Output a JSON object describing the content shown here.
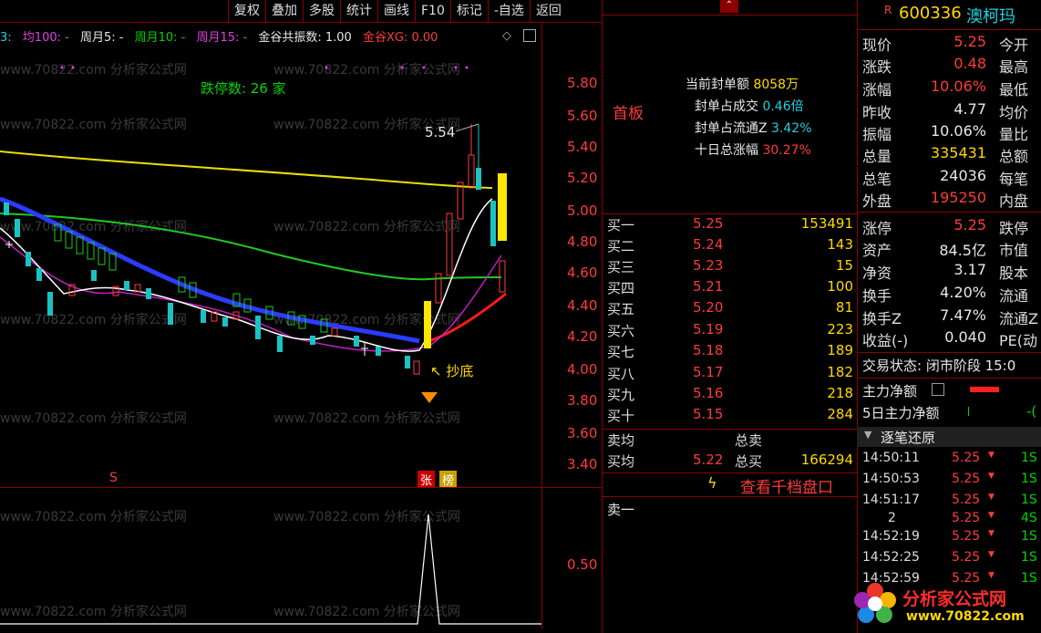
{
  "toolbar": {
    "buttons": [
      "复权",
      "叠加",
      "多股",
      "统计",
      "画线",
      "F10",
      "标记",
      "-自选",
      "返回"
    ]
  },
  "indicators": {
    "ma100": "均100: -",
    "week5": "周月5: -",
    "week10": "周月10: -",
    "week15": "周月15: -",
    "resonance": "金谷共振数: 1.00",
    "xg": "金谷XG: 0.00",
    "prefix": "3:"
  },
  "chart": {
    "limit_down_count": "跌停数: 26 家",
    "high_label": "5.54",
    "bottom_label": "抄底",
    "marker_s": "S",
    "badge_zhang": "张",
    "badge_bang": "榜",
    "price_axis": [
      "5.80",
      "5.60",
      "5.40",
      "5.20",
      "5.00",
      "4.80",
      "4.60",
      "4.40",
      "4.20",
      "4.00",
      "3.80",
      "3.60",
      "3.40"
    ],
    "sub_axis": "0.50",
    "watermark": "www.70822.com 分析家公式网"
  },
  "seal": {
    "first_board": "首板",
    "order_amount_label": "当前封单额",
    "order_amount": "8058万",
    "order_turnover_label": "封单占成交",
    "order_turnover": "0.46倍",
    "order_float_label": "封单占流通Z",
    "order_float": "3.42%",
    "ten_day_label": "十日总涨幅",
    "ten_day": "30.27%"
  },
  "orderbook": {
    "bids": [
      {
        "label": "买一",
        "price": "5.25",
        "vol": "153491"
      },
      {
        "label": "买二",
        "price": "5.24",
        "vol": "143"
      },
      {
        "label": "买三",
        "price": "5.23",
        "vol": "15"
      },
      {
        "label": "买四",
        "price": "5.21",
        "vol": "100"
      },
      {
        "label": "买五",
        "price": "5.20",
        "vol": "81"
      },
      {
        "label": "买六",
        "price": "5.19",
        "vol": "223"
      },
      {
        "label": "买七",
        "price": "5.18",
        "vol": "189"
      },
      {
        "label": "买八",
        "price": "5.17",
        "vol": "182"
      },
      {
        "label": "买九",
        "price": "5.16",
        "vol": "218"
      },
      {
        "label": "买十",
        "price": "5.15",
        "vol": "284"
      }
    ],
    "sell_avg_label": "卖均",
    "total_sell_label": "总卖",
    "buy_avg_label": "买均",
    "buy_avg": "5.22",
    "total_buy_label": "总买",
    "total_buy": "166294",
    "view_thousand": "查看千档盘口",
    "sell_one": "卖一"
  },
  "quote": {
    "code": "600336",
    "name": "澳柯玛",
    "flag": "R",
    "rows": [
      {
        "label": "现价",
        "value": "5.25",
        "color": "red",
        "label2": "今开"
      },
      {
        "label": "涨跌",
        "value": "0.48",
        "color": "red",
        "label2": "最高"
      },
      {
        "label": "涨幅",
        "value": "10.06%",
        "color": "red",
        "label2": "最低"
      },
      {
        "label": "昨收",
        "value": "4.77",
        "color": "white",
        "label2": "均价"
      },
      {
        "label": "振幅",
        "value": "10.06%",
        "color": "white",
        "label2": "量比"
      },
      {
        "label": "总量",
        "value": "335431",
        "color": "yellow",
        "label2": "总额"
      },
      {
        "label": "总笔",
        "value": "24036",
        "color": "white",
        "label2": "每笔"
      },
      {
        "label": "外盘",
        "value": "195250",
        "color": "red",
        "label2": "内盘"
      }
    ],
    "rows2": [
      {
        "label": "涨停",
        "value": "5.25",
        "color": "red",
        "label2": "跌停"
      },
      {
        "label": "资产",
        "value": "84.5亿",
        "color": "white",
        "label2": "市值"
      },
      {
        "label": "净资",
        "value": "3.17",
        "color": "white",
        "label2": "股本"
      },
      {
        "label": "换手",
        "value": "4.20%",
        "color": "white",
        "label2": "流通"
      },
      {
        "label": "换手Z",
        "value": "7.47%",
        "color": "white",
        "label2": "流通Z"
      },
      {
        "label": "收益(-)",
        "value": "0.040",
        "color": "white",
        "label2": "PE(动"
      }
    ],
    "trade_status": "交易状态: 闭市阶段 15:0",
    "main_net": "主力净额",
    "main_net_5d": "5日主力净额",
    "tick_title": "逐笔还原",
    "ticks": [
      {
        "time": "14:50:11",
        "price": "5.25",
        "vol": "1S"
      },
      {
        "time": "14:50:53",
        "price": "5.25",
        "vol": "1S"
      },
      {
        "time": "14:51:17",
        "price": "5.25",
        "vol": "1S"
      },
      {
        "time": "2",
        "price": "5.25",
        "vol": "4S"
      },
      {
        "time": "14:52:19",
        "price": "5.25",
        "vol": "1S"
      },
      {
        "time": "14:52:25",
        "price": "5.25",
        "vol": "1S"
      },
      {
        "time": "14:52:59",
        "price": "5.25",
        "vol": "1S"
      }
    ],
    "logo_text": "分析家公式网",
    "logo_url": "www.70822.com"
  }
}
